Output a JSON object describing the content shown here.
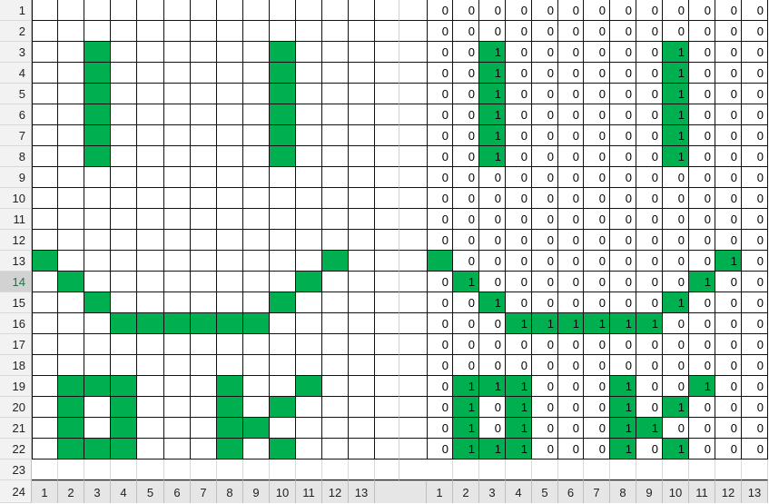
{
  "sheet": {
    "row_labels": [
      "1",
      "2",
      "3",
      "4",
      "5",
      "6",
      "7",
      "8",
      "9",
      "10",
      "11",
      "12",
      "13",
      "14",
      "15",
      "16",
      "17",
      "18",
      "19",
      "20",
      "21",
      "22",
      "23",
      "24"
    ],
    "active_row": "14",
    "left_col_labels": [
      "1",
      "2",
      "3",
      "4",
      "5",
      "6",
      "7",
      "8",
      "9",
      "10",
      "11",
      "12",
      "13"
    ],
    "right_col_labels": [
      "1",
      "2",
      "3",
      "4",
      "5",
      "6",
      "7",
      "8",
      "9",
      "10",
      "11",
      "12",
      "13"
    ],
    "fill_color": "#00b050",
    "grid": [
      "0000000000000",
      "0000000000000",
      "0010000001000",
      "0010000001000",
      "0010000001000",
      "0010000001000",
      "0010000001000",
      "0010000001000",
      "0000000000000",
      "0000000000000",
      "0000000000000",
      "0000000000000",
      "1000000000010",
      "0100000000100",
      "0010000001000",
      "0001111110000",
      "0000000000000",
      "0000000000000",
      "0111000100100",
      "0101000101000",
      "0101000110000",
      "0111000101000"
    ],
    "right_blank_cells": [
      [
        12,
        0
      ]
    ]
  }
}
